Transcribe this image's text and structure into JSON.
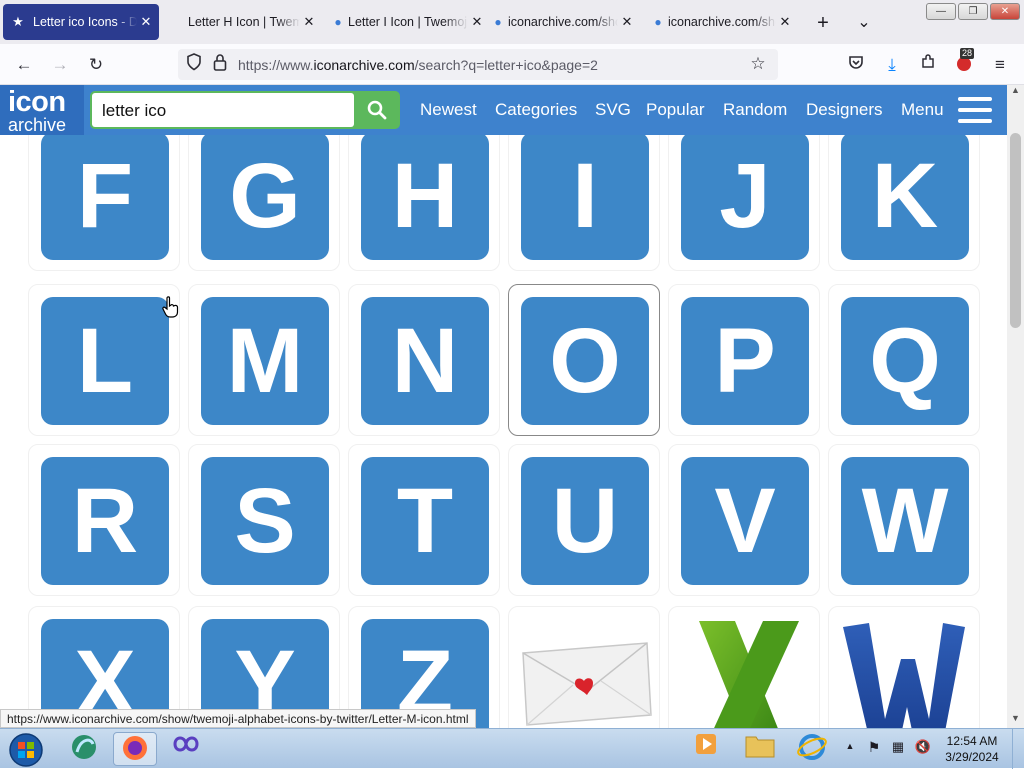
{
  "tabs": [
    {
      "title": "Letter ico Icons - Do",
      "active": true
    },
    {
      "title": "Letter H Icon | Twemoji",
      "active": false
    },
    {
      "title": "Letter I Icon | Twemoji",
      "active": false
    },
    {
      "title": "iconarchive.com/show",
      "active": false
    },
    {
      "title": "iconarchive.com/show",
      "active": false
    }
  ],
  "url": {
    "prefix": "https://www.",
    "domain": "iconarchive.com",
    "path": "/search?q=letter+ico&page=2"
  },
  "extension_badge": "28",
  "site": {
    "logo_line1": "icon",
    "logo_line2": "archive",
    "search_value": "letter ico",
    "nav": [
      "Newest",
      "Categories",
      "SVG",
      "Popular",
      "Random",
      "Designers",
      "Menu"
    ]
  },
  "grid": [
    {
      "letter": "F"
    },
    {
      "letter": "G"
    },
    {
      "letter": "H"
    },
    {
      "letter": "I"
    },
    {
      "letter": "J"
    },
    {
      "letter": "K"
    },
    {
      "letter": "L"
    },
    {
      "letter": "M"
    },
    {
      "letter": "N"
    },
    {
      "letter": "O"
    },
    {
      "letter": "P"
    },
    {
      "letter": "Q"
    },
    {
      "letter": "R"
    },
    {
      "letter": "S"
    },
    {
      "letter": "T"
    },
    {
      "letter": "U"
    },
    {
      "letter": "V"
    },
    {
      "letter": "W"
    },
    {
      "letter": "X"
    },
    {
      "letter": "Y"
    },
    {
      "letter": "Z"
    },
    {
      "icon": "envelope-heart-icon"
    },
    {
      "icon": "green-x-icon"
    },
    {
      "icon": "blue-w-icon"
    }
  ],
  "status_url": "https://www.iconarchive.com/show/twemoji-alphabet-icons-by-twitter/Letter-M-icon.html",
  "clock": {
    "time": "12:54 AM",
    "date": "3/29/2024"
  },
  "colors": {
    "tile": "#3d87c8",
    "header": "#3e82cd",
    "search_button": "#5cb85c",
    "active_tab": "#2b3b8f"
  }
}
